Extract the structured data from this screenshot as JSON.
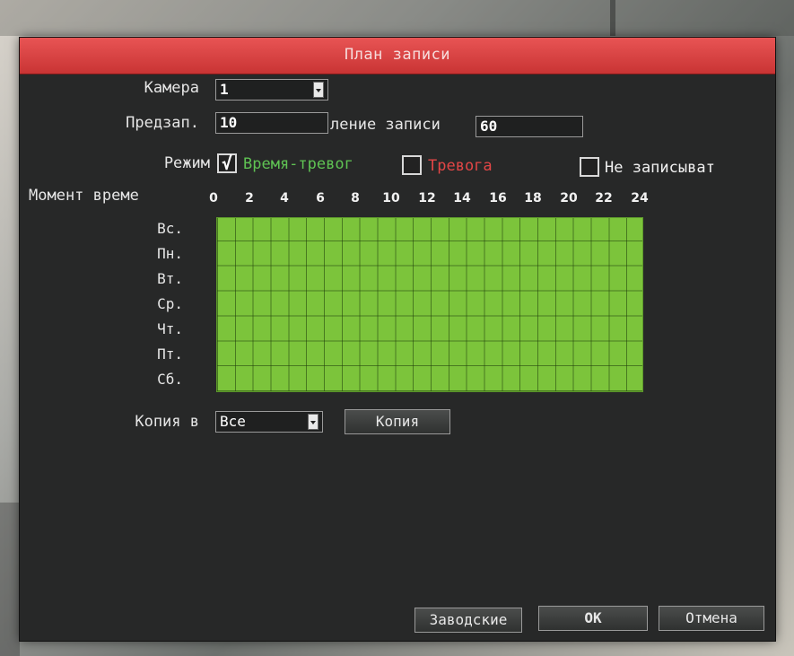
{
  "window": {
    "title": "План записи"
  },
  "camera": {
    "label": "Камера",
    "value": "1"
  },
  "prerecord": {
    "label": "Предзап.",
    "value": "10"
  },
  "duration": {
    "label": "ление записи",
    "value": "60"
  },
  "mode": {
    "label": "Режим",
    "options": [
      {
        "label": "Время-тревог",
        "checked": true,
        "color": "#5fc253"
      },
      {
        "label": "Тревога",
        "checked": false,
        "color": "#e34646"
      },
      {
        "label": "Не записыват",
        "checked": false,
        "color": "#f0f0f0"
      }
    ],
    "check_mark": "√"
  },
  "schedule": {
    "time_label": "Момент време",
    "hours": [
      "0",
      "2",
      "4",
      "6",
      "8",
      "10",
      "12",
      "14",
      "16",
      "18",
      "20",
      "22",
      "24"
    ],
    "days": [
      "Вс.",
      "Пн.",
      "Вт.",
      "Ср.",
      "Чт.",
      "Пт.",
      "Сб."
    ],
    "fill_color": "#7cc43b",
    "all_slots_enabled": true
  },
  "copy": {
    "label": "Копия в",
    "value": "Все",
    "button": "Копия"
  },
  "footer": {
    "defaults": "Заводские",
    "ok": "OK",
    "cancel": "Отмена"
  }
}
